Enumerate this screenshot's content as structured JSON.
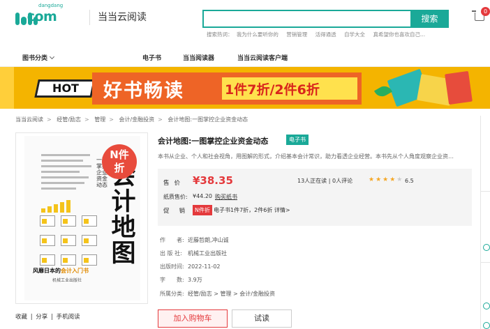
{
  "header": {
    "logo_small": "dangdang",
    "logo_big": ".com",
    "site_name": "当当云阅读",
    "search": {
      "value": "",
      "placeholder": "",
      "button": "搜索"
    },
    "hot_label": "搜索热词：",
    "hot_words": [
      "我为什么要听你的",
      "营销管理",
      "活得通透",
      "自学大全",
      "真希望你也喜欢自己..."
    ],
    "cart_count": "0"
  },
  "nav": {
    "items": [
      "图书分类",
      "电子书",
      "当当阅读器",
      "当当云阅读客户端"
    ]
  },
  "banner": {
    "hot": "HOT",
    "title": "好书畅读",
    "promo": "1件7折/2件6折"
  },
  "breadcrumb": [
    "当当云阅读",
    "经管/励志",
    "管理",
    "会计/金融投资",
    "会计地图:一图掌控企业资金动态"
  ],
  "cover": {
    "badge_line1": "N件",
    "badge_line2": "折",
    "title": "会计地图",
    "subtitle": "一图掌控企业资金动态",
    "tagline_prefix": "风靡日本的",
    "tagline_highlight": "会计入门书",
    "publisher": "机械工业出版社"
  },
  "actions": [
    "收藏",
    "分享",
    "手机阅读"
  ],
  "book": {
    "title": "会计地图:一图掌控企业资金动态",
    "type_tag": "电子书",
    "description": "本书从企业、个人和社会视角，用图解的形式，介绍基本会计常识，助力看透企业经营。本书先从个人角度观察企业资…",
    "price_label": "售价",
    "price": "¥38.35",
    "readers": "13人正在读",
    "reviews": "0人评论",
    "stars": "★★★★",
    "stars_dim": "★",
    "rating": "6.5",
    "paper_label": "纸质售价:",
    "paper_price": "¥44.20",
    "paper_link": "购买纸书",
    "promo_label": "促销:",
    "promo_tag": "N件折",
    "promo_text": "电子书1件7折，2件6折",
    "promo_link": "详情>",
    "meta": [
      {
        "k": "作　　者:",
        "v": "近藤哲朗,冲山诚"
      },
      {
        "k": "出  版  社:",
        "v": "机械工业出版社"
      },
      {
        "k": "出版时间:",
        "v": "2022-11-02"
      },
      {
        "k": "字　　数:",
        "v": "3.9万"
      },
      {
        "k": "所属分类:",
        "v": "经管/励志 > 管理 > 会计/金融投资"
      }
    ],
    "add_to_cart": "加入购物车",
    "trial": "试读"
  },
  "colors": {
    "brand": "#1aa998",
    "price_red": "#e4393c",
    "banner_orange": "#ee6426",
    "banner_yellow": "#f4b400"
  }
}
